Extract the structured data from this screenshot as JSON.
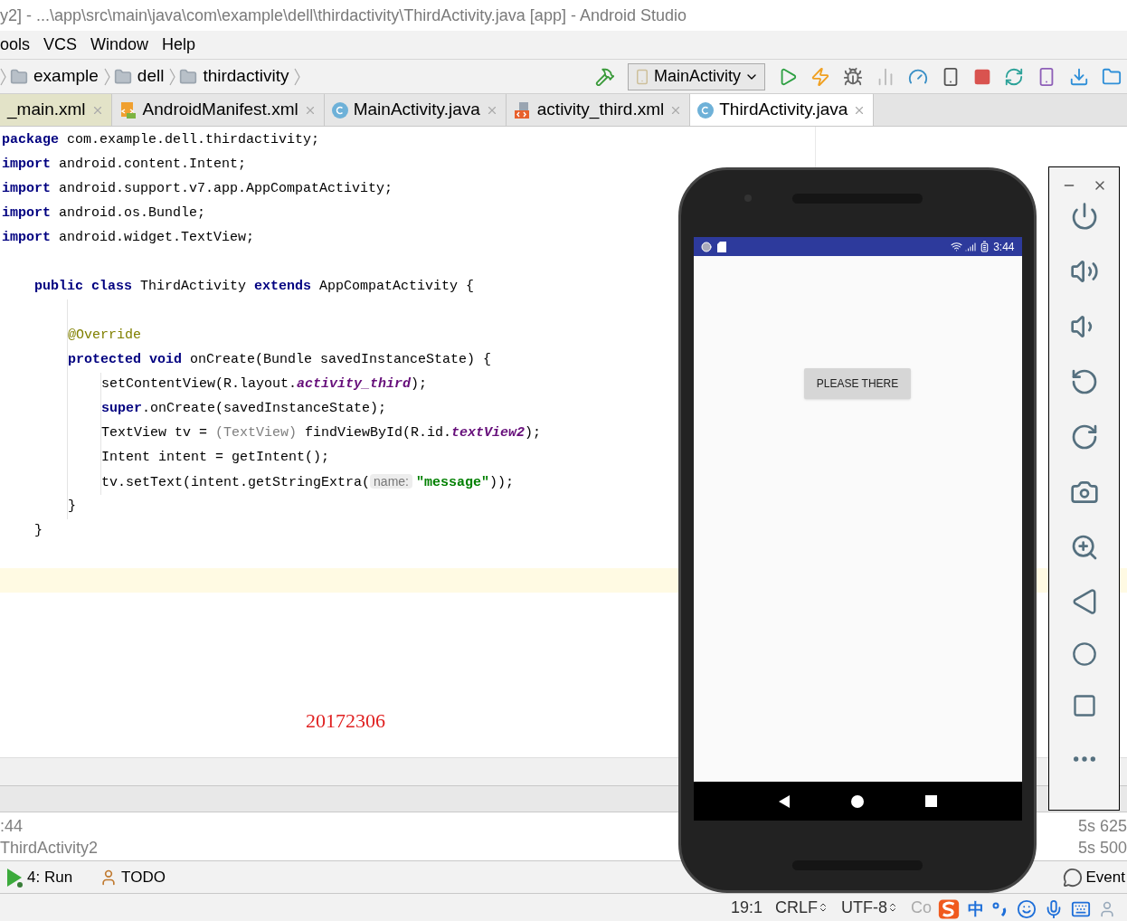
{
  "window": {
    "title": "y2] - ...\\app\\src\\main\\java\\com\\example\\dell\\thirdactivity\\ThirdActivity.java [app] - Android Studio"
  },
  "menu": [
    {
      "label": "ools"
    },
    {
      "label": "VCS"
    },
    {
      "label": "Window"
    },
    {
      "label": "Help"
    }
  ],
  "breadcrumbs": [
    "example",
    "dell",
    "thirdactivity"
  ],
  "run_config": "MainActivity",
  "tabs": [
    {
      "label": "_main.xml",
      "selected": false
    },
    {
      "label": "AndroidManifest.xml",
      "kind": "manifest",
      "selected": false
    },
    {
      "label": "MainActivity.java",
      "kind": "class",
      "selected": false
    },
    {
      "label": "activity_third.xml",
      "kind": "layout",
      "selected": false
    },
    {
      "label": "ThirdActivity.java",
      "kind": "class",
      "selected": true
    }
  ],
  "editor": {
    "lines": [
      {
        "tokens": [
          {
            "kind": "keyword",
            "text": "package"
          },
          {
            "kind": "plain",
            "text": " com.example.dell.thirdactivity;"
          }
        ]
      },
      {
        "tokens": [
          {
            "kind": "keyword",
            "text": "import"
          },
          {
            "kind": "plain",
            "text": " android.content.Intent;"
          }
        ]
      },
      {
        "tokens": [
          {
            "kind": "keyword",
            "text": "import"
          },
          {
            "kind": "plain",
            "text": " android.support.v7.app.AppCompatActivity;"
          }
        ]
      },
      {
        "tokens": [
          {
            "kind": "keyword",
            "text": "import"
          },
          {
            "kind": "plain",
            "text": " android.os.Bundle;"
          }
        ]
      },
      {
        "tokens": [
          {
            "kind": "keyword",
            "text": "import"
          },
          {
            "kind": "plain",
            "text": " android.widget.TextView;"
          }
        ]
      },
      {
        "kind": "blank"
      },
      {
        "kind": "block",
        "children": [
          {
            "tokens": [
              {
                "kind": "keyword",
                "text": "public class"
              },
              {
                "kind": "plain",
                "text": " ThirdActivity "
              },
              {
                "kind": "keyword",
                "text": "extends"
              },
              {
                "kind": "plain",
                "text": " AppCompatActivity {"
              }
            ],
            "children": [
              {
                "kind": "blank"
              },
              {
                "tokens": [
                  {
                    "kind": "annotation",
                    "text": "@Override"
                  }
                ]
              },
              {
                "tokens": [
                  {
                    "kind": "keyword",
                    "text": "protected void"
                  },
                  {
                    "kind": "plain",
                    "text": " onCreate(Bundle savedInstanceState) {"
                  }
                ],
                "children": [
                  {
                    "tokens": [
                      {
                        "kind": "plain",
                        "text": "setContentView(R.layout."
                      },
                      {
                        "kind": "field",
                        "text": "activity_third"
                      },
                      {
                        "kind": "plain",
                        "text": ");"
                      }
                    ]
                  },
                  {
                    "tokens": [
                      {
                        "kind": "keyword",
                        "text": "super"
                      },
                      {
                        "kind": "plain",
                        "text": ".onCreate(savedInstanceState);"
                      }
                    ]
                  },
                  {
                    "tokens": [
                      {
                        "kind": "plain",
                        "text": "TextView tv = "
                      },
                      {
                        "kind": "cast",
                        "text": "(TextView)"
                      },
                      {
                        "kind": "plain",
                        "text": " findViewById(R.id."
                      },
                      {
                        "kind": "field",
                        "text": "textView2"
                      },
                      {
                        "kind": "plain",
                        "text": ");"
                      }
                    ]
                  },
                  {
                    "tokens": [
                      {
                        "kind": "plain",
                        "text": "Intent intent = getIntent();"
                      }
                    ]
                  },
                  {
                    "tokens": [
                      {
                        "kind": "plain",
                        "text": "tv.setText(intent.getStringExtra("
                      },
                      {
                        "kind": "hint",
                        "text": "name:"
                      },
                      {
                        "kind": "string",
                        "text": "\"message\""
                      },
                      {
                        "kind": "plain",
                        "text": "));"
                      }
                    ]
                  }
                ]
              },
              {
                "tokens": [
                  {
                    "kind": "plain",
                    "text": "}"
                  }
                ]
              }
            ]
          },
          {
            "tokens": [
              {
                "kind": "plain",
                "text": "}"
              }
            ]
          }
        ]
      },
      {
        "kind": "blank"
      },
      {
        "kind": "blank",
        "current": true
      }
    ],
    "note": "20172306"
  },
  "run_panel": {
    "lines": [
      ":44",
      "ThirdActivity2"
    ],
    "times": [
      "5s 625",
      "5s 500"
    ]
  },
  "tool_windows": [
    {
      "label": "4: Run",
      "kind": "run"
    },
    {
      "label": "TODO",
      "kind": "todo"
    }
  ],
  "event_log": "Event",
  "status_bar": {
    "position": "19:1",
    "line_separator": "CRLF",
    "encoding": "UTF-8",
    "context": "Co"
  },
  "ime": {
    "mode": "中"
  },
  "emulator": {
    "status_time": "3:44",
    "button": "PLEASE THERE"
  }
}
